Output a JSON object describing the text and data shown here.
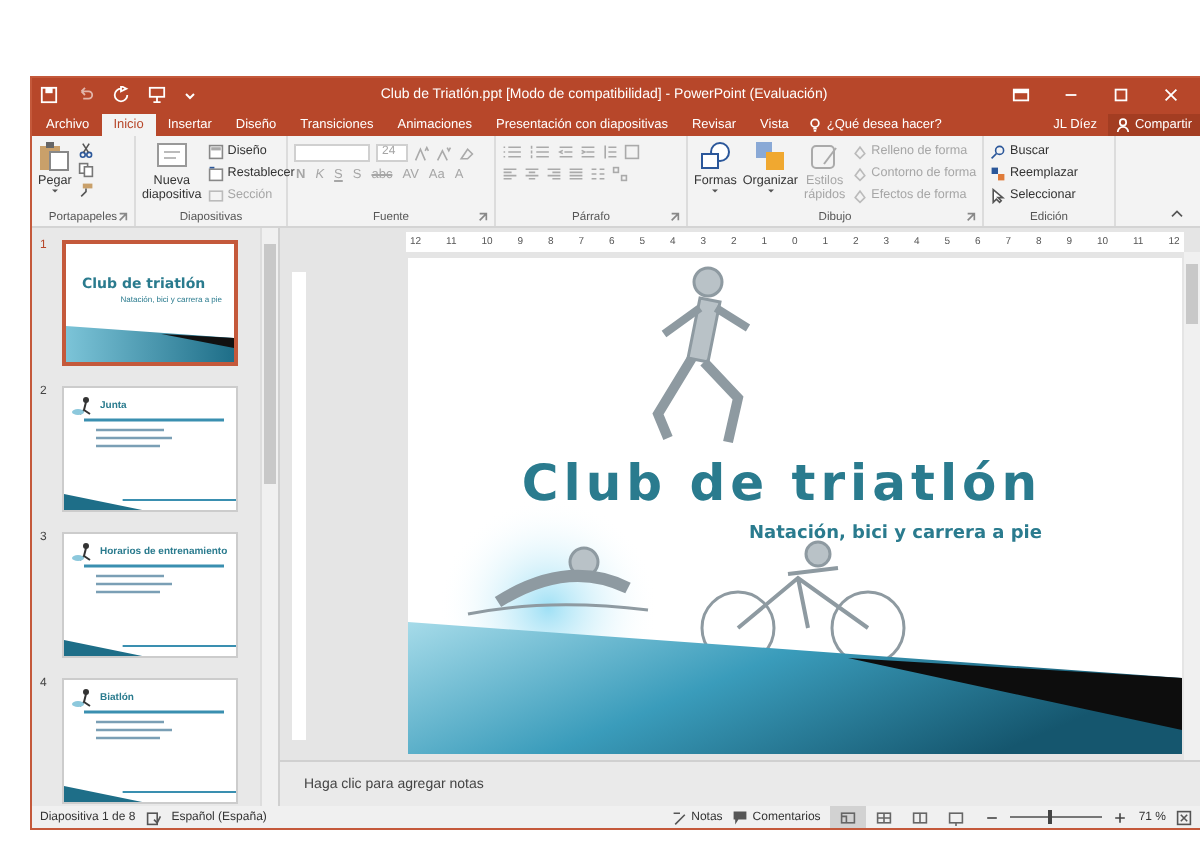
{
  "window": {
    "title": "Club de Triatlón.ppt [Modo de compatibilidad] - PowerPoint (Evaluación)"
  },
  "tabs": [
    {
      "label": "Archivo",
      "selected": false
    },
    {
      "label": "Inicio",
      "selected": true
    },
    {
      "label": "Insertar",
      "selected": false
    },
    {
      "label": "Diseño",
      "selected": false
    },
    {
      "label": "Transiciones",
      "selected": false
    },
    {
      "label": "Animaciones",
      "selected": false
    },
    {
      "label": "Presentación con diapositivas",
      "selected": false
    },
    {
      "label": "Revisar",
      "selected": false
    },
    {
      "label": "Vista",
      "selected": false
    }
  ],
  "tell_me": "¿Qué desea hacer?",
  "user": "JL Díez",
  "share": "Compartir",
  "ribbon": {
    "clipboard": {
      "paste": "Pegar",
      "label": "Portapapeles"
    },
    "slides": {
      "new_slide_1": "Nueva",
      "new_slide_2": "diapositiva",
      "layout": "Diseño",
      "reset": "Restablecer",
      "section": {
        "label": "Sección",
        "disabled": true
      },
      "label": "Diapositivas"
    },
    "font": {
      "size": "24",
      "disabled": true,
      "label": "Fuente",
      "buttons": [
        {
          "label": "N",
          "kind": "bold"
        },
        {
          "label": "K",
          "kind": "italic"
        },
        {
          "label": "S",
          "kind": "underline"
        },
        {
          "label": "S",
          "kind": "shadow"
        },
        {
          "label": "abc",
          "kind": "strike"
        },
        {
          "label": "AV",
          "kind": "spacing"
        },
        {
          "label": "Aa",
          "kind": "case"
        },
        {
          "label": "A",
          "kind": "color"
        }
      ]
    },
    "paragraph": {
      "label": "Párrafo",
      "disabled": true
    },
    "drawing": {
      "shapes": "Formas",
      "arrange": "Organizar",
      "quick_styles_1": "Estilos",
      "quick_styles_2": "rápidos",
      "quick_styles_disabled": true,
      "options": [
        {
          "label": "Relleno de forma",
          "disabled": true
        },
        {
          "label": "Contorno de forma",
          "disabled": true
        },
        {
          "label": "Efectos de forma",
          "disabled": true
        }
      ],
      "label": "Dibujo"
    },
    "editing": {
      "find": "Buscar",
      "replace": "Reemplazar",
      "select": "Seleccionar",
      "label": "Edición"
    }
  },
  "thumbnails": [
    {
      "number": "1",
      "selected": true,
      "kind": "title",
      "title": "Club de triatlón",
      "subtitle": "Natación, bici y carrera a pie"
    },
    {
      "number": "2",
      "selected": false,
      "kind": "content",
      "title": "Junta"
    },
    {
      "number": "3",
      "selected": false,
      "kind": "content",
      "title": "Horarios de entrenamiento"
    },
    {
      "number": "4",
      "selected": false,
      "kind": "content",
      "title": "Biatlón"
    }
  ],
  "ruler": [
    "12",
    "11",
    "10",
    "9",
    "8",
    "7",
    "6",
    "5",
    "4",
    "3",
    "2",
    "1",
    "0",
    "1",
    "2",
    "3",
    "4",
    "5",
    "6",
    "7",
    "8",
    "9",
    "10",
    "11",
    "12"
  ],
  "slide": {
    "title": "Club de triatlón",
    "subtitle": "Natación, bici y carrera a pie"
  },
  "notes_prompt": "Haga clic para agregar notas",
  "status_bar": {
    "slide_counter": "Diapositiva 1 de 8",
    "language": "Español (España)",
    "notes": "Notas",
    "comments": "Comentarios",
    "views": [
      {
        "selected": true
      },
      {
        "selected": false
      },
      {
        "selected": false
      },
      {
        "selected": false
      }
    ],
    "zoom": {
      "level": 0.4
    },
    "zoom_text": "71 %"
  }
}
